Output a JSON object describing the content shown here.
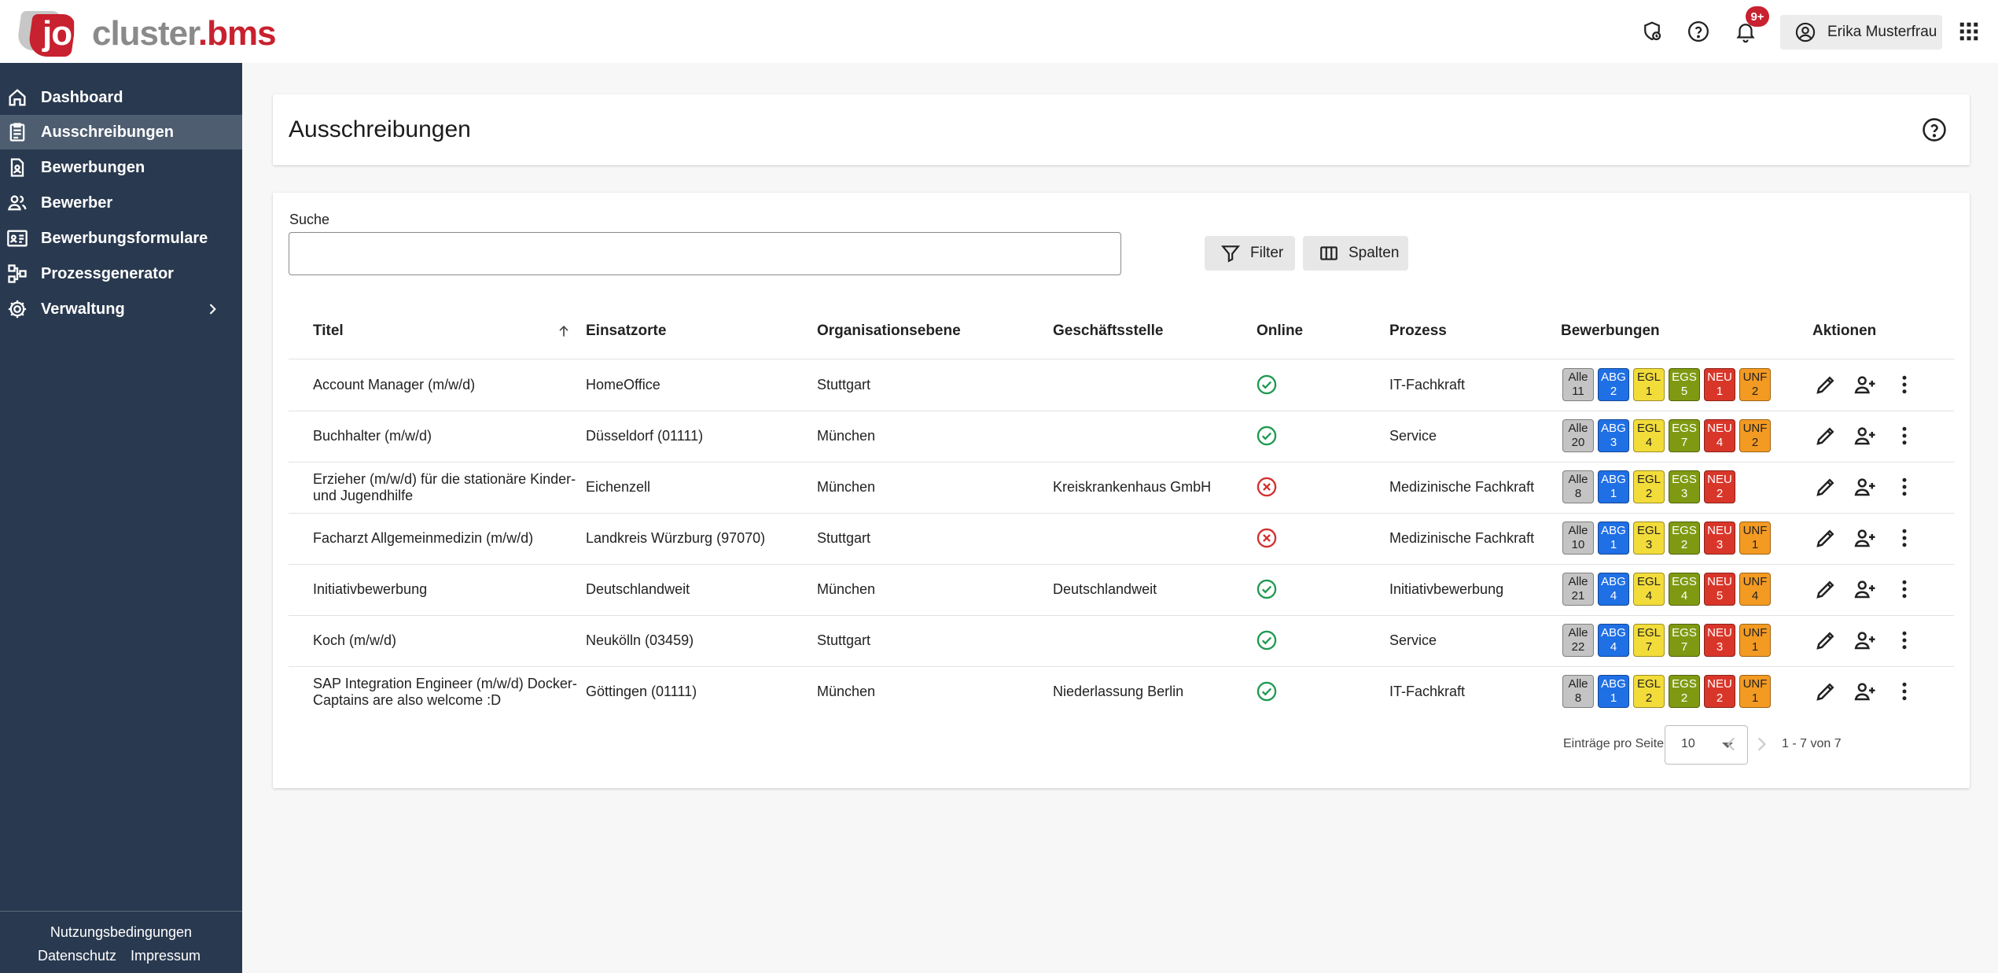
{
  "header": {
    "logo": {
      "part1": "job",
      "part2": "cluster",
      "part3": ".bms"
    },
    "notifications_badge": "9+",
    "user_name": "Erika Musterfrau"
  },
  "sidebar": {
    "items": [
      {
        "label": "Dashboard",
        "icon": "home-icon"
      },
      {
        "label": "Ausschreibungen",
        "icon": "clipboard-icon"
      },
      {
        "label": "Bewerbungen",
        "icon": "document-person-icon"
      },
      {
        "label": "Bewerber",
        "icon": "people-icon"
      },
      {
        "label": "Bewerbungsformulare",
        "icon": "form-card-icon"
      },
      {
        "label": "Prozessgenerator",
        "icon": "flow-icon"
      },
      {
        "label": "Verwaltung",
        "icon": "gear-icon"
      }
    ],
    "footer": {
      "terms": "Nutzungsbedingungen",
      "privacy": "Datenschutz",
      "imprint": "Impressum"
    }
  },
  "page": {
    "title": "Ausschreibungen"
  },
  "search": {
    "label": "Suche",
    "value": ""
  },
  "toolbar": {
    "filter_label": "Filter",
    "columns_label": "Spalten"
  },
  "table": {
    "columns": [
      "Titel",
      "Einsatzorte",
      "Organisationsebene",
      "Geschäftsstelle",
      "Online",
      "Prozess",
      "Bewerbungen",
      "Aktionen"
    ],
    "rows": [
      {
        "title": "Account Manager (m/w/d)",
        "location": "HomeOffice",
        "org": "Stuttgart",
        "office": "",
        "online": true,
        "process": "IT-Fachkraft",
        "apps": {
          "alle": "11",
          "abg": "2",
          "egl": "1",
          "egs": "5",
          "neu": "1",
          "unf": "2"
        }
      },
      {
        "title": "Buchhalter (m/w/d)",
        "location": "Düsseldorf (01111)",
        "org": "München",
        "office": "",
        "online": true,
        "process": "Service",
        "apps": {
          "alle": "20",
          "abg": "3",
          "egl": "4",
          "egs": "7",
          "neu": "4",
          "unf": "2"
        }
      },
      {
        "title": "Erzieher (m/w/d) für die stationäre Kinder- und Jugendhilfe",
        "location": "Eichenzell",
        "org": "München",
        "office": "Kreiskrankenhaus GmbH",
        "online": false,
        "process": "Medizinische Fachkraft",
        "apps": {
          "alle": "8",
          "abg": "1",
          "egl": "2",
          "egs": "3",
          "neu": "2",
          "unf": null
        }
      },
      {
        "title": "Facharzt Allgemeinmedizin (m/w/d)",
        "location": "Landkreis Würzburg (97070)",
        "org": "Stuttgart",
        "office": "",
        "online": false,
        "process": "Medizinische Fachkraft",
        "apps": {
          "alle": "10",
          "abg": "1",
          "egl": "3",
          "egs": "2",
          "neu": "3",
          "unf": "1"
        }
      },
      {
        "title": "Initiativbewerbung",
        "location": "Deutschlandweit",
        "org": "München",
        "office": "Deutschlandweit",
        "online": true,
        "process": "Initiativbewerbung",
        "apps": {
          "alle": "21",
          "abg": "4",
          "egl": "4",
          "egs": "4",
          "neu": "5",
          "unf": "4"
        }
      },
      {
        "title": "Koch (m/w/d)",
        "location": "Neukölln (03459)",
        "org": "Stuttgart",
        "office": "",
        "online": true,
        "process": "Service",
        "apps": {
          "alle": "22",
          "abg": "4",
          "egl": "7",
          "egs": "7",
          "neu": "3",
          "unf": "1"
        }
      },
      {
        "title": "SAP Integration Engineer (m/w/d) Docker-Captains are also welcome :D",
        "location": "Göttingen (01111)",
        "org": "München",
        "office": "Niederlassung Berlin",
        "online": true,
        "process": "IT-Fachkraft",
        "apps": {
          "alle": "8",
          "abg": "1",
          "egl": "2",
          "egs": "2",
          "neu": "2",
          "unf": "1"
        }
      }
    ],
    "badge_labels": {
      "alle": "Alle",
      "abg": "ABG",
      "egl": "EGL",
      "egs": "EGS",
      "neu": "NEU",
      "unf": "UNF"
    }
  },
  "badge_colors": {
    "alle": {
      "bg": "#c4c4c4",
      "fg": "#222222"
    },
    "abg": {
      "bg": "#1f6fe5",
      "fg": "#ffffff"
    },
    "egl": {
      "bg": "#f2dc3a",
      "fg": "#222222"
    },
    "egs": {
      "bg": "#7f9a12",
      "fg": "#ffffff"
    },
    "neu": {
      "bg": "#d9362a",
      "fg": "#ffffff"
    },
    "unf": {
      "bg": "#f39a22",
      "fg": "#222222"
    }
  },
  "status_colors": {
    "online": "#1e9a50",
    "offline": "#d32f2f"
  },
  "pagination": {
    "per_page_label": "Einträge pro Seite",
    "per_page_value": "10",
    "range": "1 - 7 von 7"
  },
  "colors": {
    "sidebar_bg": "#29394f",
    "sidebar_active": "#4e5d70",
    "brand_red": "#c8212f"
  }
}
